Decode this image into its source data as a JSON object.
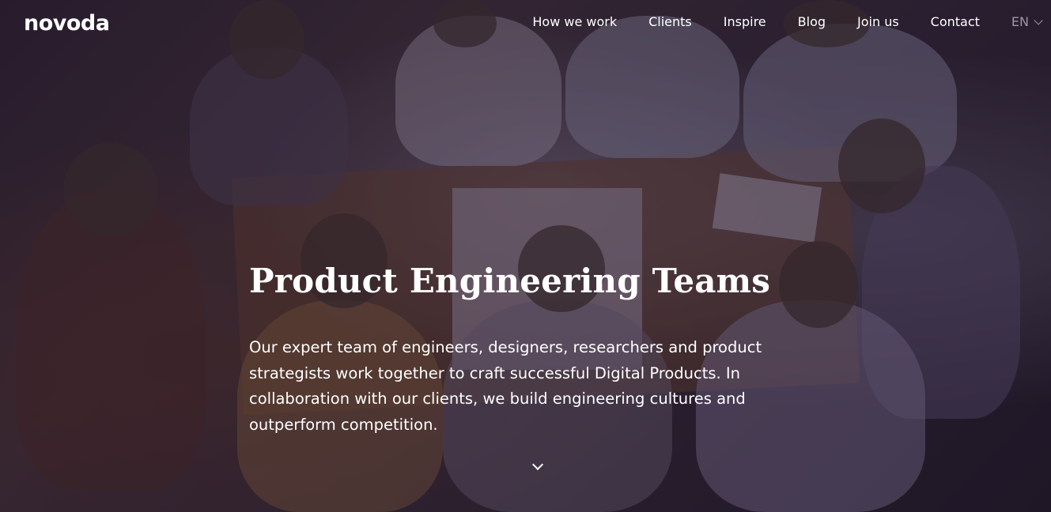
{
  "brand": {
    "logo_text": "novoda"
  },
  "nav": {
    "items": [
      {
        "label": "How we work"
      },
      {
        "label": "Clients"
      },
      {
        "label": "Inspire"
      },
      {
        "label": "Blog"
      },
      {
        "label": "Join us"
      },
      {
        "label": "Contact"
      }
    ],
    "language": {
      "selected": "EN"
    }
  },
  "hero": {
    "title": "Product Engineering Teams",
    "description": "Our expert team of engineers, designers, researchers and product strategists work together to craft successful Digital Products. In collaboration with our clients, we build engineering cultures and outperform competition.",
    "scroll_icon": "chevron-down-icon"
  },
  "colors": {
    "text": "#ffffff",
    "language_text": "#9a98a6"
  }
}
